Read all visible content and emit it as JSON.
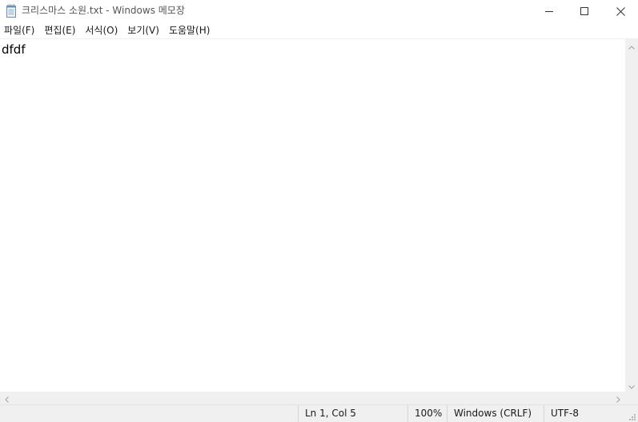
{
  "window": {
    "title": "크리스마스 소원.txt - Windows 메모장",
    "icon": "notepad-icon",
    "controls": {
      "minimize": "minimize-icon",
      "maximize": "maximize-icon",
      "close": "close-icon"
    }
  },
  "menu": {
    "items": [
      {
        "label": "파일(F)"
      },
      {
        "label": "편집(E)"
      },
      {
        "label": "서식(O)"
      },
      {
        "label": "보기(V)"
      },
      {
        "label": "도움말(H)"
      }
    ]
  },
  "editor": {
    "content": "dfdf"
  },
  "status": {
    "position": "Ln 1, Col 5",
    "zoom": "100%",
    "line_ending": "Windows (CRLF)",
    "encoding": "UTF-8"
  },
  "colors": {
    "chrome_bg": "#f0f0f0",
    "text": "#000000",
    "title_text": "#555555"
  }
}
